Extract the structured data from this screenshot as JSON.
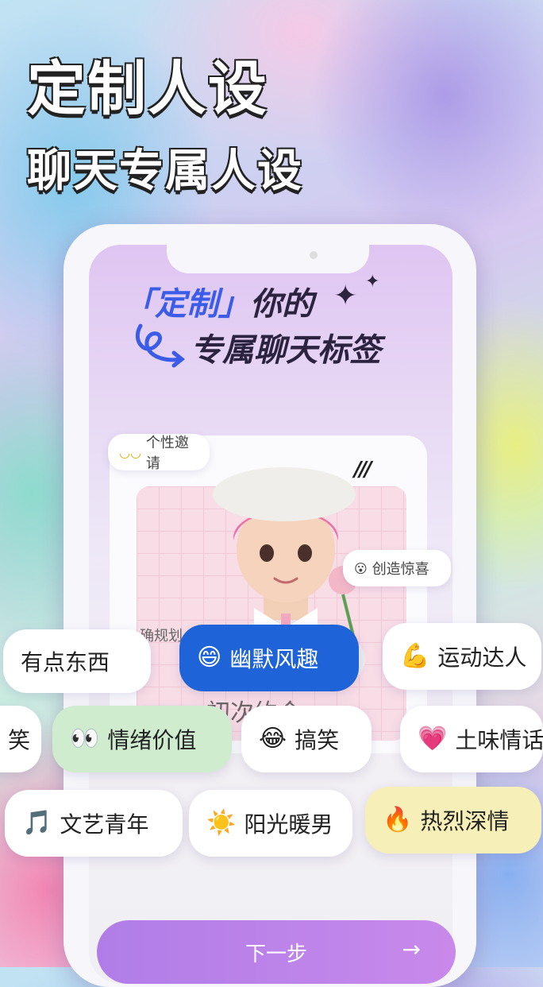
{
  "hero": {
    "line1": "定制人设",
    "line2": "聊天专属人设"
  },
  "screen": {
    "title_bracket_open": "「",
    "title_custom": "定制",
    "title_bracket_close": "」",
    "title_rest": "你的",
    "subtitle": "专属聊天标签",
    "invite_label": "个性邀请",
    "invite_icon": "handshake-icon",
    "surprise_label": "创造惊喜",
    "surprise_icon": "hushed-face-icon",
    "planning_fragment": "确规划",
    "hidden_text": "初次约会",
    "next_label": "下一步",
    "next_arrow": "→"
  },
  "tags": [
    {
      "label": "有点东西",
      "emoji": "",
      "selected": false
    },
    {
      "label": "幽默风趣",
      "emoji": "😄",
      "selected": true
    },
    {
      "label": "运动达人",
      "emoji": "💪",
      "selected": false
    },
    {
      "label": "笑",
      "emoji": "",
      "selected": false
    },
    {
      "label": "情绪价值",
      "emoji": "👀",
      "selected": true
    },
    {
      "label": "搞笑",
      "emoji": "😂",
      "selected": false
    },
    {
      "label": "土味情话",
      "emoji": "💗",
      "selected": false
    },
    {
      "label": "文艺青年",
      "emoji": "🎵",
      "selected": false
    },
    {
      "label": "阳光暖男",
      "emoji": "☀️",
      "selected": false
    },
    {
      "label": "热烈深情",
      "emoji": "🔥",
      "selected": true
    }
  ],
  "colors": {
    "selected_blue": "#1f63d8",
    "selected_green": "#cfeccf",
    "selected_yellow": "#f7efb8",
    "accent_purple": "#b883e8"
  }
}
